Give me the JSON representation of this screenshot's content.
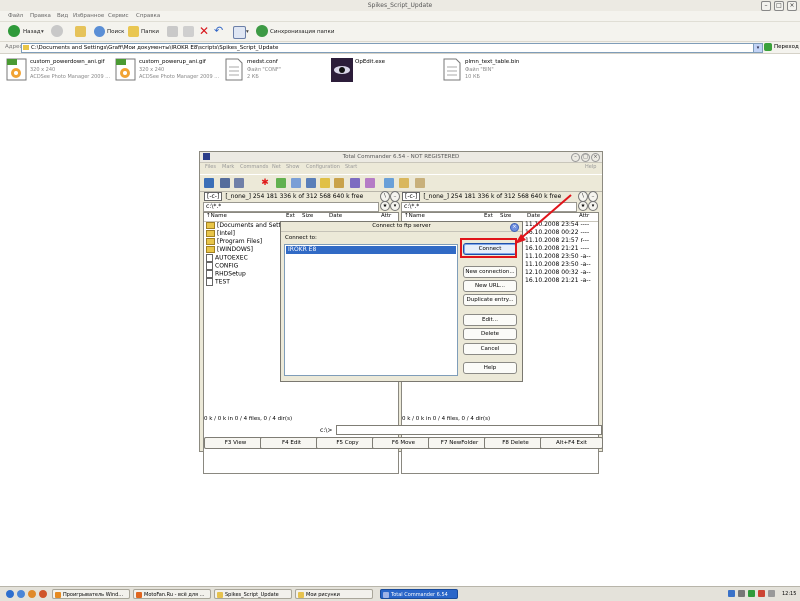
{
  "explorer": {
    "window_title": "Spikes_Script_Update",
    "menu": [
      "Файл",
      "Правка",
      "Вид",
      "Избранное",
      "Сервис",
      "Справка"
    ],
    "toolbar": {
      "back": "Назад",
      "search": "Поиск",
      "folders": "Папки",
      "sync": "Синхронизация папки"
    },
    "address": {
      "label": "Адрес",
      "value": "C:\\Documents and Settings\\Graff\\Мои документы\\IROKR E8\\scripts\\Spikes_Script_Update",
      "go": "Переход"
    },
    "files": [
      {
        "name": "custom_powerdown_ani.gif",
        "line1": "320 x 240",
        "line2": "ACDSee Photo Manager 2009 ...",
        "icon": "gif-image-icon"
      },
      {
        "name": "custom_powerup_ani.gif",
        "line1": "320 x 240",
        "line2": "ACDSee Photo Manager 2009 ...",
        "icon": "gif-image-icon"
      },
      {
        "name": "medst.conf",
        "line1": "Файл \"CONF\"",
        "line2": "2 КБ",
        "icon": "document-icon"
      },
      {
        "name": "OpEdit.exe",
        "line1": "",
        "line2": "",
        "icon": "eye-exe-icon"
      },
      {
        "name": "plmn_text_table.bin",
        "line1": "Файл \"BIN\"",
        "line2": "10 КБ",
        "icon": "document-icon"
      }
    ]
  },
  "tc": {
    "title": "Total Commander 6.54 - NOT REGISTERED",
    "menu": [
      "Files",
      "Mark",
      "Commands",
      "Net",
      "Show",
      "Configuration",
      "Start"
    ],
    "help_menu": "Help",
    "left": {
      "drive": "[-c-]",
      "drive_info": "[_none_]  254 181 336 k of 312 568 640 k free",
      "path": "c:\\*.*",
      "headers": {
        "name": "↑Name",
        "ext": "Ext",
        "size": "Size",
        "date": "Date",
        "attr": "Attr"
      },
      "rows": [
        {
          "name": "[Documents and Settings]",
          "folder": true
        },
        {
          "name": "[Intel]",
          "folder": true
        },
        {
          "name": "[Program Files]",
          "folder": true
        },
        {
          "name": "[WINDOWS]",
          "folder": true
        },
        {
          "name": "AUTOEXEC",
          "folder": false
        },
        {
          "name": "CONFIG",
          "folder": false
        },
        {
          "name": "RHDSetup",
          "folder": false
        },
        {
          "name": "TEST",
          "folder": false
        }
      ],
      "status": "0 k / 0 k in 0 / 4 files, 0 / 4 dir(s)"
    },
    "right": {
      "drive": "[-c-]",
      "drive_info": "[_none_]  254 181 336 k of 312 568 640 k free",
      "path": "c:\\*.*",
      "headers": {
        "name": "↑Name",
        "ext": "Ext",
        "size": "Size",
        "date": "Date",
        "attr": "Attr"
      },
      "dates": [
        "11.10.2008 23:54 ----",
        "16.10.2008 00:22 ----",
        "11.10.2008 21:57 r---",
        "16.10.2008 21:21 ----",
        "11.10.2008 23:50 -a--",
        "11.10.2008 23:50 -a--",
        "12.10.2008 00:32 -a--",
        "16.10.2008 21:21 -a--"
      ],
      "status": "0 k / 0 k in 0 / 4 files, 0 / 4 dir(s)"
    },
    "cmd_label": "c:\\>",
    "fkeys": [
      "F3 View",
      "F4 Edit",
      "F5 Copy",
      "F6 Move",
      "F7 NewFolder",
      "F8 Delete",
      "Alt+F4 Exit"
    ]
  },
  "dialog": {
    "title": "Connect to ftp server",
    "connect_to": "Connect to:",
    "selected": "IROKR E8",
    "buttons": {
      "connect": "Connect",
      "new_connection": "New connection...",
      "new_url": "New URL...",
      "duplicate": "Duplicate entry...",
      "edit": "Edit...",
      "delete": "Delete",
      "cancel": "Cancel",
      "help": "Help"
    }
  },
  "taskbar": {
    "items": [
      "Проигрыватель Wind...",
      "MotoFan.Ru - всё для ...",
      "Spikes_Script_Update",
      "Мои рисунки",
      "Total Commander 6.54"
    ],
    "clock": "12:15"
  },
  "colors": {
    "selection": "#316ac5",
    "annotation": "#e0141a",
    "folder": "#e8c548"
  }
}
